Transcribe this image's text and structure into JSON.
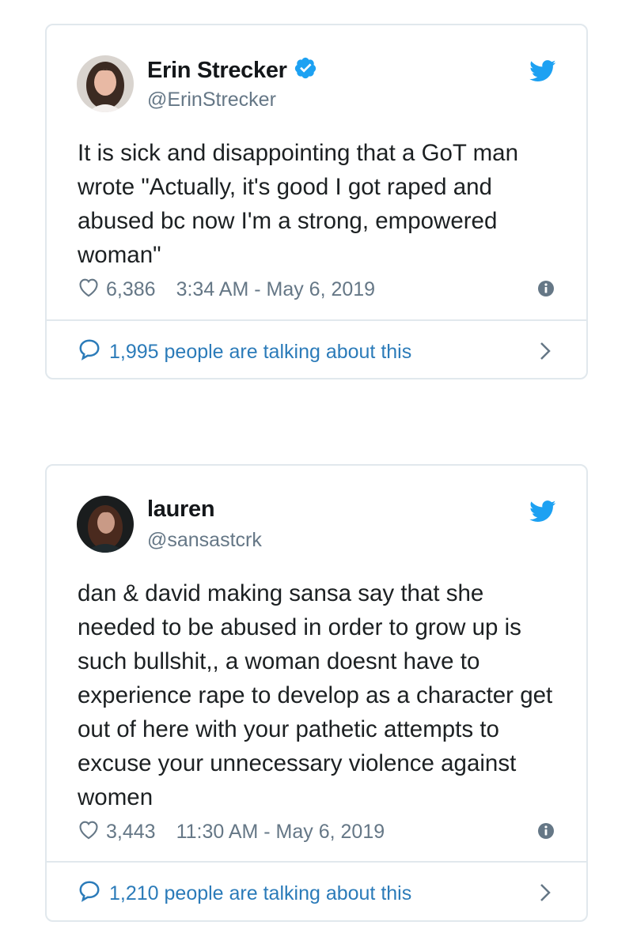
{
  "tweets": [
    {
      "display_name": "Erin Strecker",
      "verified": true,
      "handle": "@ErinStrecker",
      "text": "It is sick and disappointing that a GoT man wrote \"Actually, it's good I got raped and abused bc now I'm a strong, empowered woman\"",
      "likes": "6,386",
      "timestamp": "3:34 AM - May 6, 2019",
      "talking": "1,995 people are talking about this"
    },
    {
      "display_name": "lauren",
      "verified": false,
      "handle": "@sansastcrk",
      "text": "dan & david making sansa say that she needed to be abused in order to grow up is such bullshit,, a woman doesnt have to experience rape to develop as a character get out of here with your pathetic attempts to excuse your unnecessary violence against women",
      "likes": "3,443",
      "timestamp": "11:30 AM - May 6, 2019",
      "talking": "1,210 people are talking about this"
    }
  ],
  "icons": {
    "bird": "twitter-bird-icon",
    "verified": "verified-badge-icon",
    "heart": "heart-icon",
    "info": "info-icon",
    "comment": "comment-icon",
    "chevron": "chevron-right-icon"
  },
  "colors": {
    "twitter_blue": "#1da1f2",
    "link_blue": "#2b7bb9",
    "muted_gray": "#657786",
    "border": "#e1e8ed"
  }
}
